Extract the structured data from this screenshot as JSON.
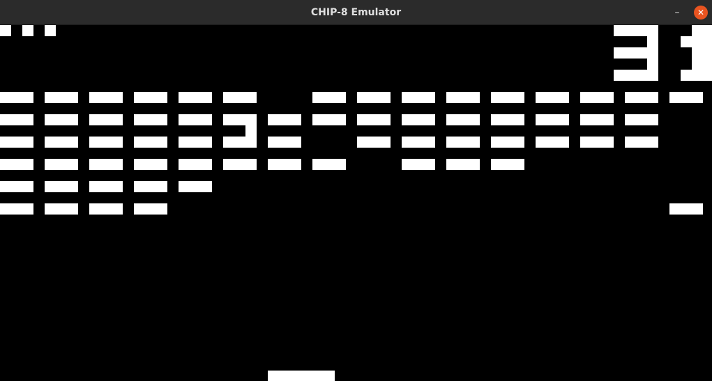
{
  "window": {
    "title": "CHIP-8 Emulator",
    "minimize_glyph": "–",
    "close_glyph": "✕",
    "close_color": "#e95420"
  },
  "game": {
    "name": "Breakout",
    "score": "31",
    "lives": 3,
    "colors": {
      "foreground": "#ffffff",
      "background": "#000000"
    }
  }
}
